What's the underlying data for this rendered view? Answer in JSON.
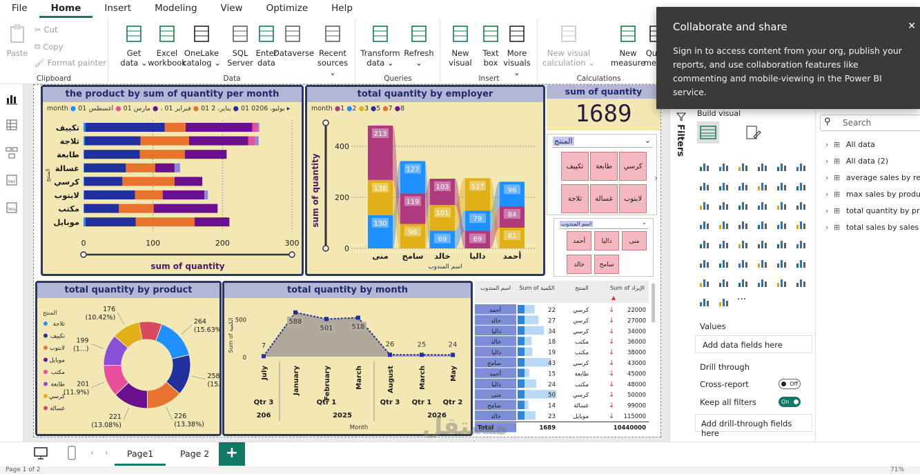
{
  "menu": [
    "File",
    "Home",
    "Insert",
    "Modeling",
    "View",
    "Optimize",
    "Help"
  ],
  "menu_active": "Home",
  "ribbon": {
    "clipboard": {
      "label": "Clipboard",
      "paste": "Paste",
      "cut": "Cut",
      "copy": "Copy",
      "format_painter": "Format painter"
    },
    "data": {
      "label": "Data",
      "buttons": [
        {
          "l1": "Get",
          "l2": "data ⌄"
        },
        {
          "l1": "Excel",
          "l2": "workbook"
        },
        {
          "l1": "OneLake",
          "l2": "catalog ⌄"
        },
        {
          "l1": "SQL",
          "l2": "Server"
        },
        {
          "l1": "Enter",
          "l2": "data"
        },
        {
          "l1": "Dataverse",
          "l2": ""
        },
        {
          "l1": "Recent",
          "l2": "sources ⌄"
        }
      ]
    },
    "queries": {
      "label": "Queries",
      "buttons": [
        {
          "l1": "Transform",
          "l2": "data ⌄"
        },
        {
          "l1": "Refresh",
          "l2": "⌄"
        }
      ]
    },
    "insert": {
      "label": "Insert",
      "buttons": [
        {
          "l1": "New",
          "l2": "visual"
        },
        {
          "l1": "Text",
          "l2": "box"
        },
        {
          "l1": "More",
          "l2": "visuals ⌄"
        }
      ]
    },
    "calculations": {
      "label": "Calculations",
      "buttons": [
        {
          "l1": "New visual",
          "l2": "calculation ⌄"
        },
        {
          "l1": "New",
          "l2": "measure"
        },
        {
          "l1": "Quick",
          "l2": "measu"
        }
      ]
    }
  },
  "toast": {
    "title": "Collaborate and share",
    "body": "Sign in to access content from your org, publish your reports, and use collaboration features like commenting and mobile-viewing in the Power BI service."
  },
  "filters_label": "Filters",
  "viz_pane": {
    "build_visual": "Build visual",
    "values": "Values",
    "add_data_fields": "Add data fields here",
    "drill_through": "Drill through",
    "cross_report": "Cross-report",
    "cross_report_state": "Off",
    "keep_all_filters": "Keep all filters",
    "keep_all_filters_state": "On",
    "add_drill_fields": "Add drill-through fields here",
    "more": "···"
  },
  "data_pane": {
    "search_placeholder": "Search",
    "tables": [
      "All data",
      "All data (2)",
      "average sales by reg",
      "max sales by produ",
      "total quantity by pr",
      "total sales by sales r"
    ]
  },
  "tabs": [
    "Page1",
    "Page 2"
  ],
  "tab_add": "+",
  "status": {
    "page": "Page 1 of 2",
    "zoom": "71%"
  },
  "watermark": {
    "arabic": "مستقل",
    "latin": "mostaql.com"
  },
  "visuals": {
    "v1": {
      "title": "the product by sum of quantity per month",
      "legend_title": "month",
      "legend_items": [
        "يوليو، 0206 01",
        "يناير، 2 01",
        "فبراير 01 ،",
        "مارس 01",
        "أغسطس 01"
      ],
      "legend_arrow": "▸",
      "y_title": "المنتج",
      "x_title": "sum of quantity",
      "categories": [
        "تكييف",
        "ثلاجة",
        "طابعة",
        "غسالة",
        "كرسي",
        "لابتوب",
        "مكتب",
        "موبايل"
      ],
      "x_ticks": [
        "0",
        "100",
        "200",
        "300"
      ]
    },
    "v2": {
      "title": "total quantity by employer",
      "legend_title": "month",
      "legend_items": [
        "1",
        "2",
        "3",
        "5",
        "7",
        "8"
      ],
      "y_title": "sum of quantity",
      "x_title": "اسم المندوب",
      "y_ticks": [
        "400",
        "200",
        "0"
      ],
      "employees": [
        "منى",
        "سامح",
        "خالد",
        "داليا",
        "أحمد"
      ]
    },
    "v3": {
      "title": "sum of quantity",
      "value": "1689"
    },
    "slicer1": {
      "title": "المنتج",
      "items": [
        "كرسي",
        "طابعة",
        "تكييف",
        "لابتوب",
        "غسالة",
        "ثلاجة"
      ]
    },
    "slicer2": {
      "title": "اسم المندوب",
      "items": [
        "منى",
        "داليا",
        "أحمد",
        "سامح",
        "خالد"
      ]
    },
    "v4": {
      "title": "total quantity by product",
      "legend_title": "المنتج",
      "legend": [
        "ثلاجة",
        "تكييف",
        "لابتوب",
        "موبايل",
        "مكتب",
        "طابعة",
        "كرسي",
        "غسالة"
      ]
    },
    "v5": {
      "title": "total quantity by month",
      "y_title": "Sum of الكمية",
      "x_title": "Month",
      "y_ticks": [
        "500",
        "0"
      ],
      "quarters": [
        "Qtr 3",
        "Qtr 1",
        "Qtr 3",
        "Qtr 1",
        "Qtr 2"
      ],
      "years": [
        "206",
        "2025",
        "2026"
      ]
    },
    "table": {
      "headers": [
        "اسم المندوب",
        "Sum of الكمية",
        "المنتج",
        "Sum of الإيراد"
      ],
      "rows": [
        [
          "أحمد",
          "22",
          "كرسي",
          "22000"
        ],
        [
          "خالد",
          "27",
          "كرسي",
          "27000"
        ],
        [
          "داليا",
          "34",
          "كرسي",
          "34000"
        ],
        [
          "خالد",
          "18",
          "مكتب",
          "36000"
        ],
        [
          "داليا",
          "19",
          "مكتب",
          "38000"
        ],
        [
          "سامح",
          "43",
          "كرسي",
          "43000"
        ],
        [
          "أحمد",
          "15",
          "طابعة",
          "45000"
        ],
        [
          "داليا",
          "24",
          "مكتب",
          "48000"
        ],
        [
          "منى",
          "50",
          "كرسي",
          "50000"
        ],
        [
          "سامح",
          "14",
          "غسالة",
          "99000"
        ],
        [
          "خالد",
          "23",
          "موبايل",
          "115000"
        ]
      ],
      "total_label": "Total",
      "total_qty": "1689",
      "total_revenue": "10440000"
    }
  },
  "chart_data": [
    {
      "type": "bar",
      "title": "the product by sum of quantity per month",
      "orientation": "horizontal-stacked",
      "categories": [
        "تكييف",
        "ثلاجة",
        "طابعة",
        "غسالة",
        "كرسي",
        "لابتوب",
        "مكتب",
        "موبايل"
      ],
      "series": [
        {
          "color": "#1e90ff",
          "values": [
            3,
            2,
            1,
            1,
            1,
            1,
            1,
            3
          ]
        },
        {
          "color": "#22309e",
          "values": [
            114,
            80,
            80,
            60,
            55,
            73,
            50,
            72
          ]
        },
        {
          "color": "#e8732e",
          "values": [
            30,
            70,
            65,
            42,
            75,
            40,
            50,
            85
          ]
        },
        {
          "color": "#6a0f8e",
          "values": [
            96,
            85,
            60,
            28,
            40,
            60,
            92,
            50
          ]
        },
        {
          "color": "#e84e9b",
          "values": [
            8,
            10,
            0,
            0,
            0,
            0,
            0,
            0
          ]
        },
        {
          "color": "#8a8ad6",
          "values": [
            2,
            5,
            0,
            8,
            0,
            5,
            0,
            0
          ]
        }
      ],
      "xlim": [
        0,
        300
      ],
      "xlabel": "sum of quantity",
      "ylabel": "المنتج"
    },
    {
      "type": "bar",
      "title": "total quantity by employer",
      "orientation": "vertical-stacked-ribbon",
      "categories": [
        "منى",
        "سامح",
        "خالد",
        "داليا",
        "أحمد"
      ],
      "series_names": [
        "1",
        "2",
        "3",
        "5",
        "7",
        "8"
      ],
      "stacks": [
        [
          {
            "value": 130,
            "color": "#1e90ff"
          },
          {
            "value": 138,
            "color": "#e0b016"
          },
          {
            "value": 213,
            "color": "#b03a7e"
          }
        ],
        [
          {
            "value": 96,
            "color": "#e0b016"
          },
          {
            "value": 119,
            "color": "#b03a7e"
          },
          {
            "value": 127,
            "color": "#1e90ff"
          }
        ],
        [
          {
            "value": 69,
            "color": "#1e90ff"
          },
          {
            "value": 101,
            "color": "#e0b016"
          },
          {
            "value": 103,
            "color": "#b03a7e"
          }
        ],
        [
          {
            "value": 69,
            "color": "#b03a7e"
          },
          {
            "value": 79,
            "color": "#1e90ff"
          },
          {
            "value": 127,
            "color": "#e0b016"
          }
        ],
        [
          {
            "value": 81,
            "color": "#e0b016"
          },
          {
            "value": 84,
            "color": "#b03a7e"
          },
          {
            "value": 96,
            "color": "#1e90ff"
          }
        ]
      ],
      "ylim": [
        0,
        500
      ],
      "ylabel": "sum of quantity",
      "xlabel": "اسم المندوب"
    },
    {
      "type": "pie",
      "title": "total quantity by product",
      "donut": true,
      "slices": [
        {
          "value": 264,
          "label": "264 (15.63%)",
          "color": "#1e90ff"
        },
        {
          "value": 258,
          "label": "258 (15...)",
          "color": "#22309e"
        },
        {
          "value": 226,
          "label": "226 (13.38%)",
          "color": "#e8732e"
        },
        {
          "value": 221,
          "label": "221 (13.08%)",
          "color": "#6a0f8e"
        },
        {
          "value": 201,
          "label": "201 (11.9%)",
          "color": "#e84e9b"
        },
        {
          "value": 199,
          "label": "199 (1...)",
          "color": "#8a4fd6"
        },
        {
          "value": 176,
          "label": "176 (10.42%)",
          "color": "#e0b016"
        },
        {
          "value": 144,
          "label": "",
          "color": "#d94a5e"
        }
      ]
    },
    {
      "type": "area",
      "title": "total quantity by month",
      "categories": [
        "July",
        "January",
        "February",
        "March",
        "August",
        "March",
        "May"
      ],
      "values": [
        7,
        588,
        501,
        518,
        26,
        25,
        24
      ],
      "ylim": [
        0,
        600
      ],
      "ylabel": "Sum of الكمية",
      "xlabel": "Month"
    }
  ]
}
